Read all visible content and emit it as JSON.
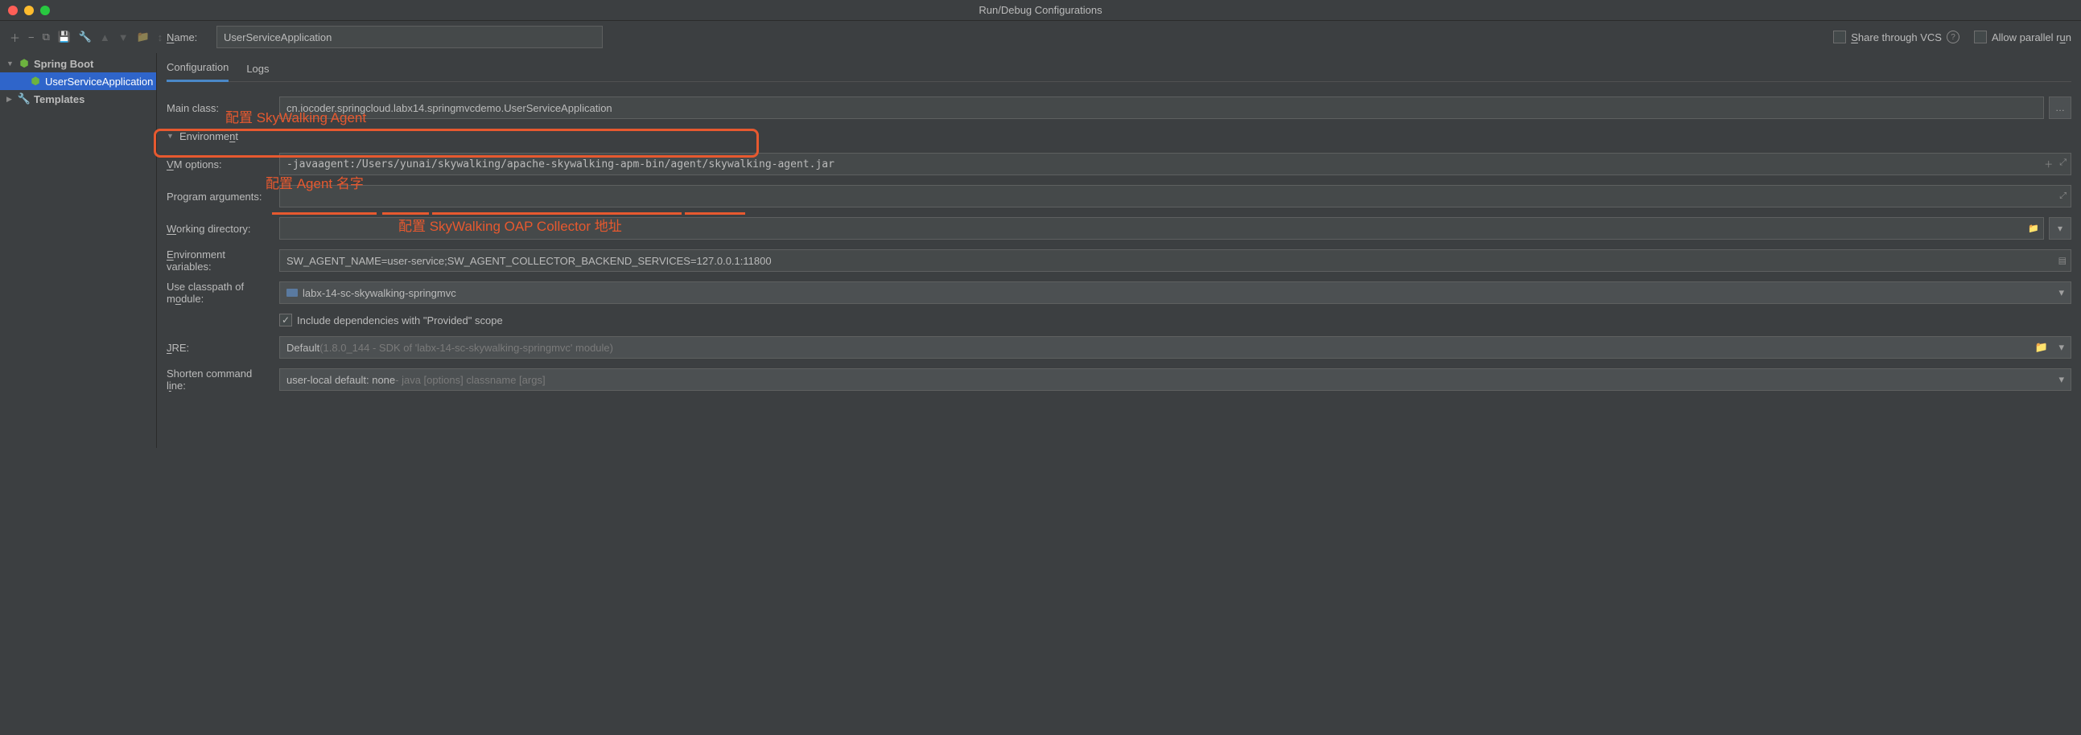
{
  "window": {
    "title": "Run/Debug Configurations"
  },
  "sidebar": {
    "springboot": "Spring Boot",
    "app": "UserServiceApplication",
    "templates": "Templates"
  },
  "header": {
    "nameLabel": "ame:",
    "nameValue": "UserServiceApplication",
    "shareVcs": "hare through VCS",
    "allowParallel": "Allow parallel r"
  },
  "tabs": {
    "config": "Configuration",
    "logs": "Logs"
  },
  "form": {
    "mainClassLabel": "Main class:",
    "mainClass": "cn.iocoder.springcloud.labx14.springmvcdemo.UserServiceApplication",
    "environment": "Environme",
    "vmLabel": "M options:",
    "vmOptions": "-javaagent:/Users/yunai/skywalking/apache-skywalking-apm-bin/agent/skywalking-agent.jar",
    "programArgsLabel": "Program ar",
    "workingDirLabel": "orking directory:",
    "workingDir": "",
    "envVarsLabel": "nvironment variables:",
    "envVars": "SW_AGENT_NAME=user-service;SW_AGENT_COLLECTOR_BACKEND_SERVICES=127.0.0.1:11800",
    "classpathLabel": "Use classpath of m",
    "classpathModule": "labx-14-sc-skywalking-springmvc",
    "includeProvided": "Include dependencies with \"Provided\" scope",
    "jreLabel": "RE:",
    "jreDefault": "Default ",
    "jreHint": "(1.8.0_144 - SDK of 'labx-14-sc-skywalking-springmvc' module)",
    "shortenLabel": "Shorten command l",
    "shortenDefault": "user-local default: none ",
    "shortenHint": "- java [options] classname [args]"
  },
  "annotations": {
    "agentConfig": "配置 SkyWalking Agent",
    "agentName": "配置 Agent 名字",
    "oapCollector": "配置 SkyWalking OAP Collector 地址"
  }
}
